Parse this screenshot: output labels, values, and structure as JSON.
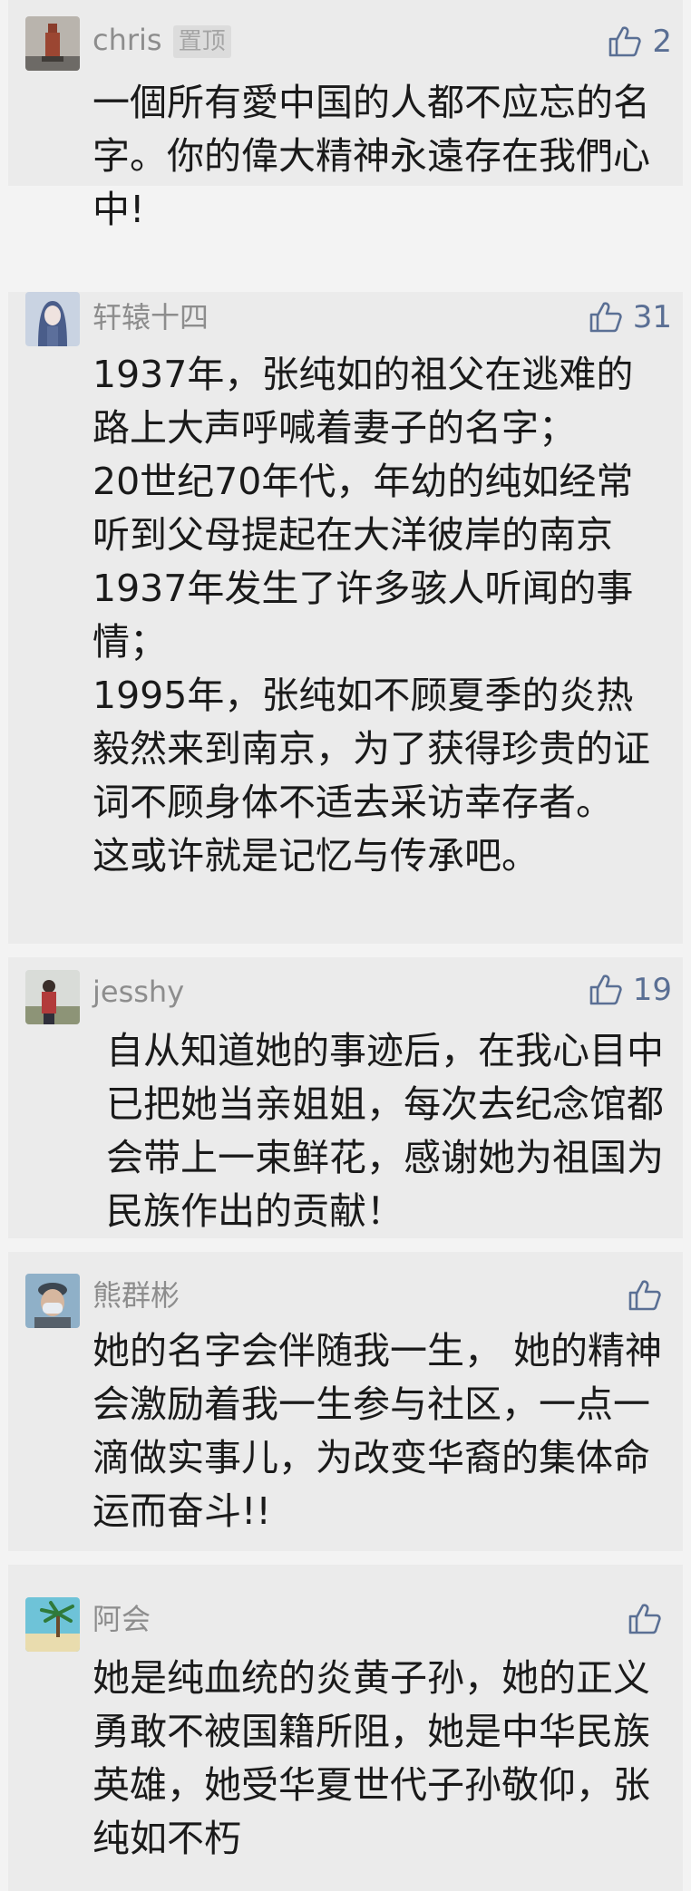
{
  "comments": [
    {
      "user": "chris",
      "pinned_label": "置顶",
      "likes": "2",
      "text": " 一個所有愛中国的人都不应忘的名字。你的偉大精神永遠存在我們心中!",
      "avatar_icon": "statue-avatar"
    },
    {
      "user": "轩辕十四",
      "likes": "31",
      "text": "1937年，张纯如的祖父在逃难的路上大声呼喊着妻子的名字；\n20世纪70年代，年幼的纯如经常听到父母提起在大洋彼岸的南京1937年发生了许多骇人听闻的事情；\n1995年，张纯如不顾夏季的炎热毅然来到南京，为了获得珍贵的证词不顾身体不适去采访幸存者。\n这或许就是记忆与传承吧。",
      "avatar_icon": "anime-girl-avatar"
    },
    {
      "user": "jesshy",
      "likes": "19",
      "text": "自从知道她的事迹后，在我心目中已把她当亲姐姐，每次去纪念馆都会带上一束鲜花，感谢她为祖国为民族作出的贡献！",
      "avatar_icon": "person-outdoor-avatar"
    },
    {
      "user": "熊群彬",
      "likes": "",
      "text": "她的名字会伴随我一生， 她的精神会激励着我一生参与社区，一点一滴做实事儿，为改变华裔的集体命运而奋斗!!",
      "avatar_icon": "masked-man-avatar"
    },
    {
      "user": "阿会",
      "likes": "",
      "text": "她是纯血统的炎黄子孙，她的正义勇敢不被国籍所阻，她是中华民族英雄，她受华夏世代子孙敬仰，张纯如不朽",
      "avatar_icon": "beach-palm-avatar"
    }
  ],
  "colors": {
    "card_bg": "#ebebeb",
    "name": "#8d8d8d",
    "like_accent": "#5a6f94",
    "text": "#1a1a1a"
  }
}
